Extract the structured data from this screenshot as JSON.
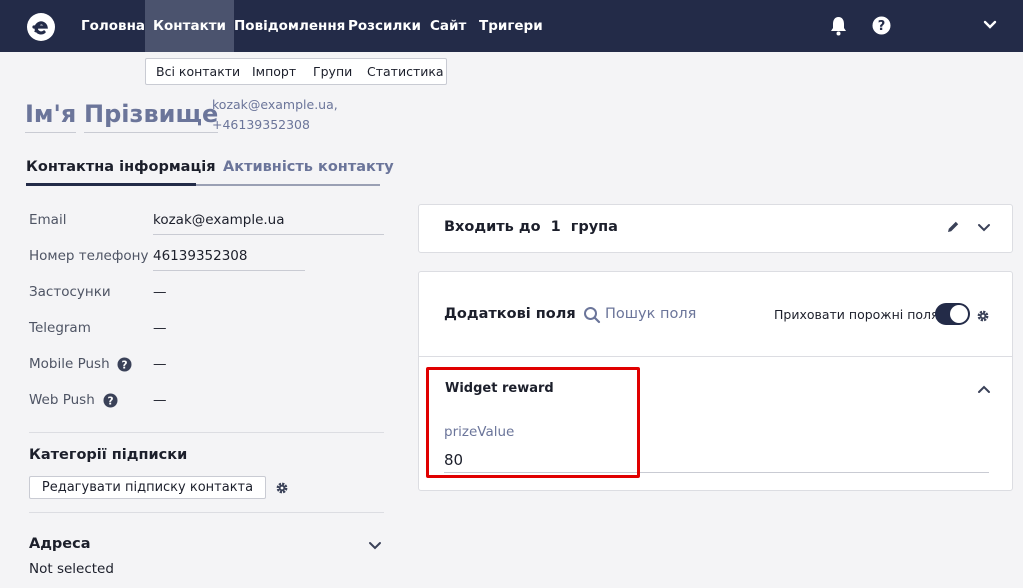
{
  "nav": {
    "items": [
      "Головна",
      "Контакти",
      "Повідомлення",
      "Розсилки",
      "Сайт",
      "Тригери"
    ],
    "active": "Контакти",
    "icons": [
      "logo-icon",
      "bell-icon",
      "help-icon",
      "chevron-down-icon"
    ]
  },
  "submenu": {
    "items": [
      "Всі контакти",
      "Імпорт",
      "Групи",
      "Статистика"
    ]
  },
  "contact": {
    "first_name": "Ім'я",
    "last_name": "Прізвище",
    "email": "kozak@example.ua,",
    "phone": "+46139352308"
  },
  "tabs": {
    "info": "Контактна інформація",
    "activity": "Активність контакту"
  },
  "fields": {
    "email_label": "Email",
    "email_value": "kozak@example.ua",
    "phone_label": "Номер телефону",
    "phone_value": "46139352308",
    "apps_label": "Застосунки",
    "apps_value": "—",
    "telegram_label": "Telegram",
    "telegram_value": "—",
    "mobile_push_label": "Mobile Push",
    "mobile_push_value": "—",
    "web_push_label": "Web Push",
    "web_push_value": "—"
  },
  "subscriptions": {
    "title": "Категорії підписки",
    "edit_button": "Редагувати підписку контакта"
  },
  "address": {
    "title": "Адреса",
    "value": "Not selected"
  },
  "groups_card": {
    "prefix": "Входить до",
    "count": "1",
    "suffix": "група"
  },
  "extra_fields": {
    "title": "Додаткові поля",
    "search_placeholder": "Пошук поля",
    "hide_empty_label": "Приховати порожні поля",
    "hide_empty_on": true,
    "widget_title": "Widget reward",
    "field_name": "prizeValue",
    "field_value": "80"
  },
  "colors": {
    "navbar": "#232b48",
    "accent": "#6b759a",
    "highlight": "#e00000"
  }
}
